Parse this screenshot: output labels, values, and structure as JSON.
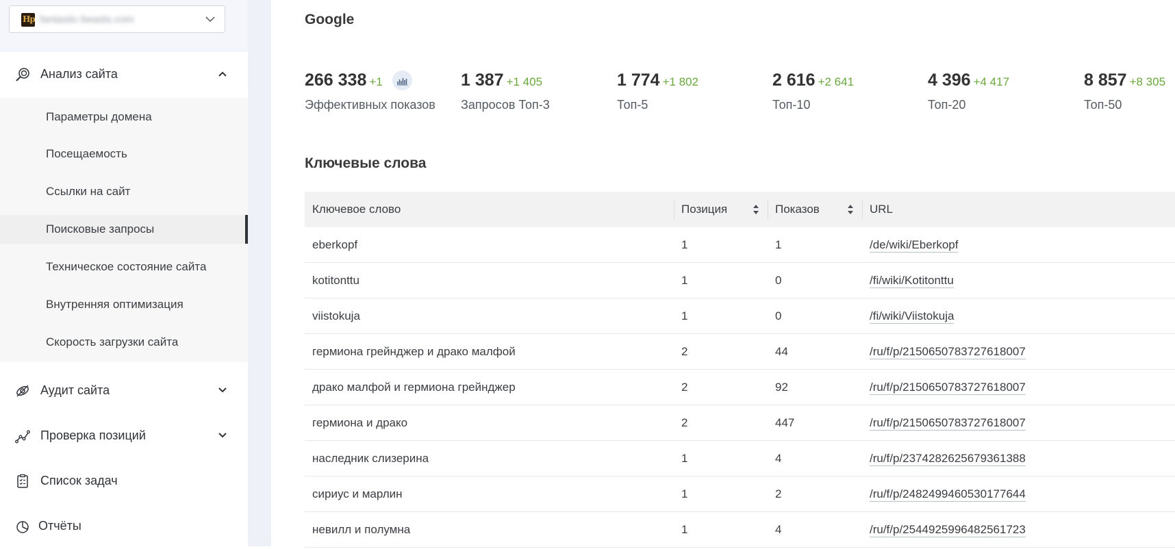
{
  "sidebar": {
    "site_select": {
      "logo_text": "Hp",
      "value": "fantastic-beasts.com"
    },
    "groups": [
      {
        "label": "Анализ сайта",
        "icon": "site-analysis-icon",
        "expanded": true
      },
      {
        "label": "Аудит сайта",
        "icon": "audit-icon",
        "expanded": false
      },
      {
        "label": "Проверка позиций",
        "icon": "positions-icon",
        "expanded": false
      },
      {
        "label": "Список задач",
        "icon": "task-list-icon"
      },
      {
        "label": "Отчёты",
        "icon": "pie-chart-icon"
      }
    ],
    "submenu": [
      {
        "label": "Параметры домена"
      },
      {
        "label": "Посещаемость"
      },
      {
        "label": "Ссылки на сайт"
      },
      {
        "label": "Поисковые запросы",
        "active": true
      },
      {
        "label": "Техническое состояние сайта"
      },
      {
        "label": "Внутренняя оптимизация"
      },
      {
        "label": "Скорость загрузки сайта"
      }
    ]
  },
  "main": {
    "engine": "Google",
    "stats": [
      {
        "value": "266 338",
        "delta": "+1",
        "caption": "Эффективных показов"
      },
      {
        "value": "1 387",
        "delta": "+1 405",
        "caption": "Запросов Топ-3"
      },
      {
        "value": "1 774",
        "delta": "+1 802",
        "caption": "Топ-5"
      },
      {
        "value": "2 616",
        "delta": "+2 641",
        "caption": "Топ-10"
      },
      {
        "value": "4 396",
        "delta": "+4 417",
        "caption": "Топ-20"
      },
      {
        "value": "8 857",
        "delta": "+8 305",
        "caption": "Топ-50"
      }
    ],
    "keywords_title": "Ключевые слова",
    "table": {
      "columns": [
        "Ключевое слово",
        "Позиция",
        "Показов",
        "URL"
      ],
      "rows": [
        [
          "eberkopf",
          "1",
          "1",
          "/de/wiki/Eberkopf"
        ],
        [
          "kotitonttu",
          "1",
          "0",
          "/fi/wiki/Kotitonttu"
        ],
        [
          "viistokuja",
          "1",
          "0",
          "/fi/wiki/Viistokuja"
        ],
        [
          "гермиона грейнджер и драко малфой",
          "2",
          "44",
          "/ru/f/p/2150650783727618007"
        ],
        [
          "драко малфой и гермиона грейнджер",
          "2",
          "92",
          "/ru/f/p/2150650783727618007"
        ],
        [
          "гермиона и драко",
          "2",
          "447",
          "/ru/f/p/2150650783727618007"
        ],
        [
          "наследник слизерина",
          "1",
          "4",
          "/ru/f/p/2374282625679361388"
        ],
        [
          "сириус и марлин",
          "1",
          "2",
          "/ru/f/p/2482499460530177644"
        ],
        [
          "невилл и полумна",
          "1",
          "4",
          "/ru/f/p/2544925996482561723"
        ]
      ]
    }
  },
  "colors": {
    "accent_green": "#6aa83b",
    "sidebar_bg": "#f4f6fb",
    "active_bar": "#2f3338"
  }
}
